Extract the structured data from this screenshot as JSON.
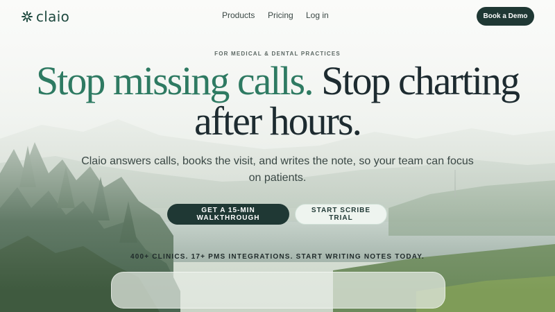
{
  "nav": {
    "logo_text": "claio",
    "links": [
      "Products",
      "Pricing",
      "Log in"
    ],
    "demo_button": "Book a Demo"
  },
  "hero": {
    "eyebrow": "FOR MEDICAL & DENTAL PRACTICES",
    "headline_accent": "Stop missing calls.",
    "headline_rest": " Stop charting after hours.",
    "subhead": "Claio answers calls, books the visit, and writes the note, so your team can focus on patients.",
    "cta_primary": "GET A 15-MIN WALKTHROUGH",
    "cta_secondary": "START SCRIBE TRIAL",
    "proof": "400+ CLINICS. 17+ PMS INTEGRATIONS. START WRITING NOTES TODAY."
  },
  "colors": {
    "brand": "#1f4a40",
    "accent": "#2e7a62",
    "dark_button": "#1f3834",
    "light_button": "#eef4ef"
  },
  "icons": {
    "logo": "asterisk-flower-icon"
  }
}
